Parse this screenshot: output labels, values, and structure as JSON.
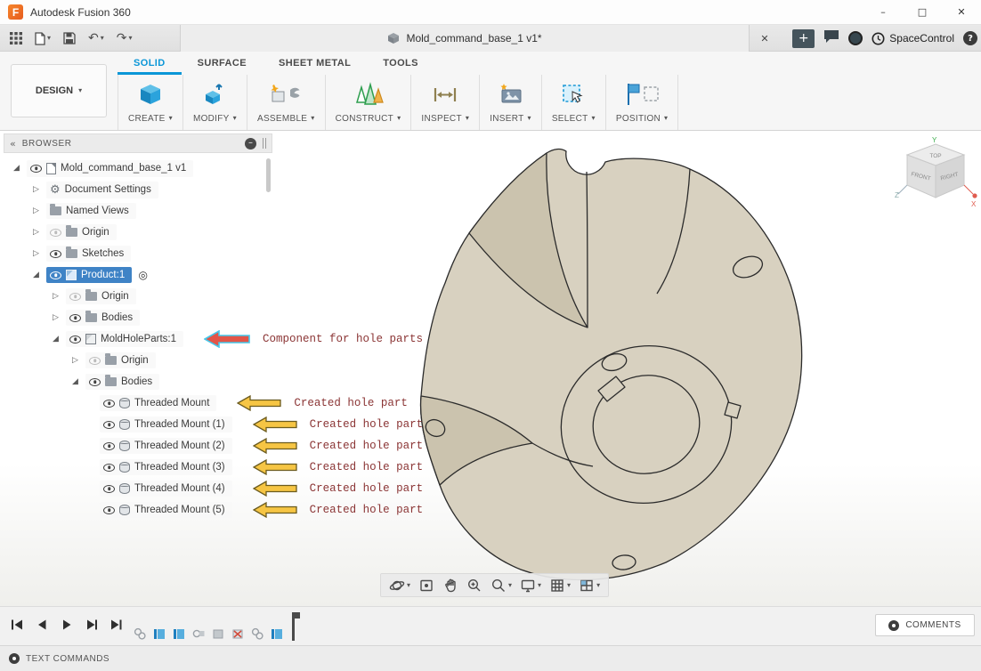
{
  "titlebar": {
    "app_title": "Autodesk Fusion 360"
  },
  "doc_tab": {
    "title": "Mold_command_base_1 v1*"
  },
  "topbar": {
    "spacecontrol_label": "SpaceControl"
  },
  "ribbon": {
    "design_label": "DESIGN",
    "tabs": [
      {
        "label": "SOLID"
      },
      {
        "label": "SURFACE"
      },
      {
        "label": "SHEET METAL"
      },
      {
        "label": "TOOLS"
      }
    ],
    "active_tab": "SOLID",
    "groups": [
      {
        "label": "CREATE"
      },
      {
        "label": "MODIFY"
      },
      {
        "label": "ASSEMBLE"
      },
      {
        "label": "CONSTRUCT"
      },
      {
        "label": "INSPECT"
      },
      {
        "label": "INSERT"
      },
      {
        "label": "SELECT"
      },
      {
        "label": "POSITION"
      }
    ]
  },
  "browser": {
    "header": "BROWSER",
    "tree": [
      {
        "label": "Mold_command_base_1 v1"
      },
      {
        "label": "Document Settings"
      },
      {
        "label": "Named Views"
      },
      {
        "label": "Origin"
      },
      {
        "label": "Sketches"
      },
      {
        "label": "Product:1"
      },
      {
        "label": "Origin"
      },
      {
        "label": "Bodies"
      },
      {
        "label": "MoldHoleParts:1"
      },
      {
        "label": "Origin"
      },
      {
        "label": "Bodies"
      },
      {
        "label": "Threaded Mount"
      },
      {
        "label": "Threaded Mount (1)"
      },
      {
        "label": "Threaded Mount (2)"
      },
      {
        "label": "Threaded Mount (3)"
      },
      {
        "label": "Threaded Mount (4)"
      },
      {
        "label": "Threaded Mount (5)"
      }
    ]
  },
  "annotations": {
    "component_note": "Component for hole parts",
    "hole_note": "Created hole part"
  },
  "viewcube": {
    "top": "TOP",
    "front": "FRONT",
    "right": "RIGHT",
    "axis_x": "X",
    "axis_y": "Y",
    "axis_z": "Z"
  },
  "bottom": {
    "comments_label": "COMMENTS",
    "text_commands_label": "TEXT COMMANDS"
  },
  "icons": {
    "caret": "▾",
    "expanded": "◢",
    "collapsed": "▷",
    "gear": "⚙",
    "collapse_panel": "«",
    "undo": "↶",
    "redo": "↷",
    "close": "✕",
    "minimize": "–",
    "maximize": "□",
    "plus": "+",
    "help": "?",
    "target": "◎",
    "minus": "–"
  },
  "colors": {
    "accent_blue": "#0a96d7",
    "selection_blue": "#3f83c6",
    "model_beige": "#d8d1c0",
    "annotation_red": "#8b3535",
    "arrow_yellow": "#f6c544"
  }
}
